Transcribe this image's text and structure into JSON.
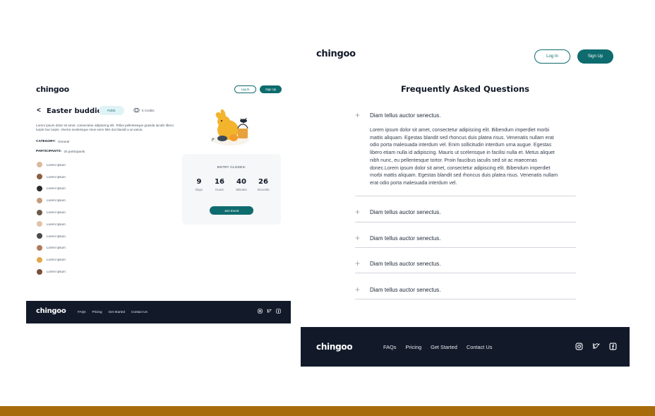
{
  "left": {
    "logo": "chingoo",
    "login": "Log In",
    "signup": "Sign Up",
    "back_glyph": "<",
    "event_title": "Easter buddies",
    "visibility_badge": "Public",
    "credits": "5 Credits",
    "description": "Lorem ipsum dolor sit amet, consectetur adipiscing elit. Tellus pellentesque gravida iaculis libero turpis hac turpis. Viverra scelerisque risus enim felis dui blandit a at varius.",
    "category_label": "CATEGORY:",
    "category_value": "General",
    "participants_label": "PARTICIPANTS:",
    "participants_value": "20 participants",
    "participants": [
      {
        "name": "Lorem Ipsum",
        "color": "#d9b99b"
      },
      {
        "name": "Lorem Ipsum",
        "color": "#8b5e3c"
      },
      {
        "name": "Lorem Ipsum",
        "color": "#2b2b2b"
      },
      {
        "name": "Lorem Ipsum",
        "color": "#c89b7b"
      },
      {
        "name": "Lorem Ipsum",
        "color": "#6b5b4b"
      },
      {
        "name": "Lorem Ipsum",
        "color": "#e2c3a6"
      },
      {
        "name": "Lorem Ipsum",
        "color": "#4a4a4a"
      },
      {
        "name": "Lorem Ipsum",
        "color": "#b07a5a"
      },
      {
        "name": "Lorem Ipsum",
        "color": "#e3a64a"
      },
      {
        "name": "Lorem Ipsum",
        "color": "#7a4f3a"
      }
    ],
    "entry_closes": "ENTRY CLOSES:",
    "countdown": [
      {
        "value": "9",
        "label": "Days"
      },
      {
        "value": "16",
        "label": "Hours"
      },
      {
        "value": "40",
        "label": "Minutes"
      },
      {
        "value": "26",
        "label": "Seconds"
      }
    ],
    "join_button": "Join Event",
    "footer": {
      "logo": "chingoo",
      "links": [
        "FAQs",
        "Pricing",
        "Get Started",
        "Contact Us"
      ],
      "icons": [
        "instagram-icon",
        "twitter-icon",
        "facebook-icon"
      ]
    }
  },
  "right": {
    "logo": "chingoo",
    "login": "Log In",
    "signup": "Sign Up",
    "faq_title": "Frequently Asked Questions",
    "faqs": [
      {
        "question": "Diam tellus auctor senectus.",
        "answer": "Lorem ipsum dolor sit amet, consectetur adipiscing elit. Bibendum imperdiet morbi mattis aliquam. Egestas blandit sed rhoncus duis platea risus. Venenatis nullam erat odio porta malesuada interdum vel. Enim sollicitudin interdum urna augue. Egestas libero etiam nulla id adipiscing. Mauris ut scelerisque in facilisi nulla et. Metus aliquet nibh nunc, eu pellentesque tortor. Proin faucibus iaculis sed sit ac maecenas donec.Lorem ipsum dolor sit amet, consectetur adipiscing elit. Bibendum imperdiet morbi mattis aliquam. Egestas blandit sed rhoncus duis platea risus. Venenatis nullam erat odio porta malesuada interdum vel."
      },
      {
        "question": "Diam tellus auctor senectus.",
        "answer": ""
      },
      {
        "question": "Diam tellus auctor senectus.",
        "answer": ""
      },
      {
        "question": "Diam tellus auctor senectus.",
        "answer": ""
      },
      {
        "question": "Diam tellus auctor senectus.",
        "answer": ""
      }
    ],
    "footer": {
      "logo": "chingoo",
      "links": [
        "FAQs",
        "Pricing",
        "Get Started",
        "Contact Us"
      ],
      "icons": [
        "instagram-icon",
        "twitter-icon",
        "facebook-icon"
      ]
    }
  },
  "colors": {
    "accent": "#0e6b6e",
    "footer_bg": "#121a2a",
    "bottom_bar": "#a86b0c",
    "badge_bg": "#dff3f7"
  }
}
